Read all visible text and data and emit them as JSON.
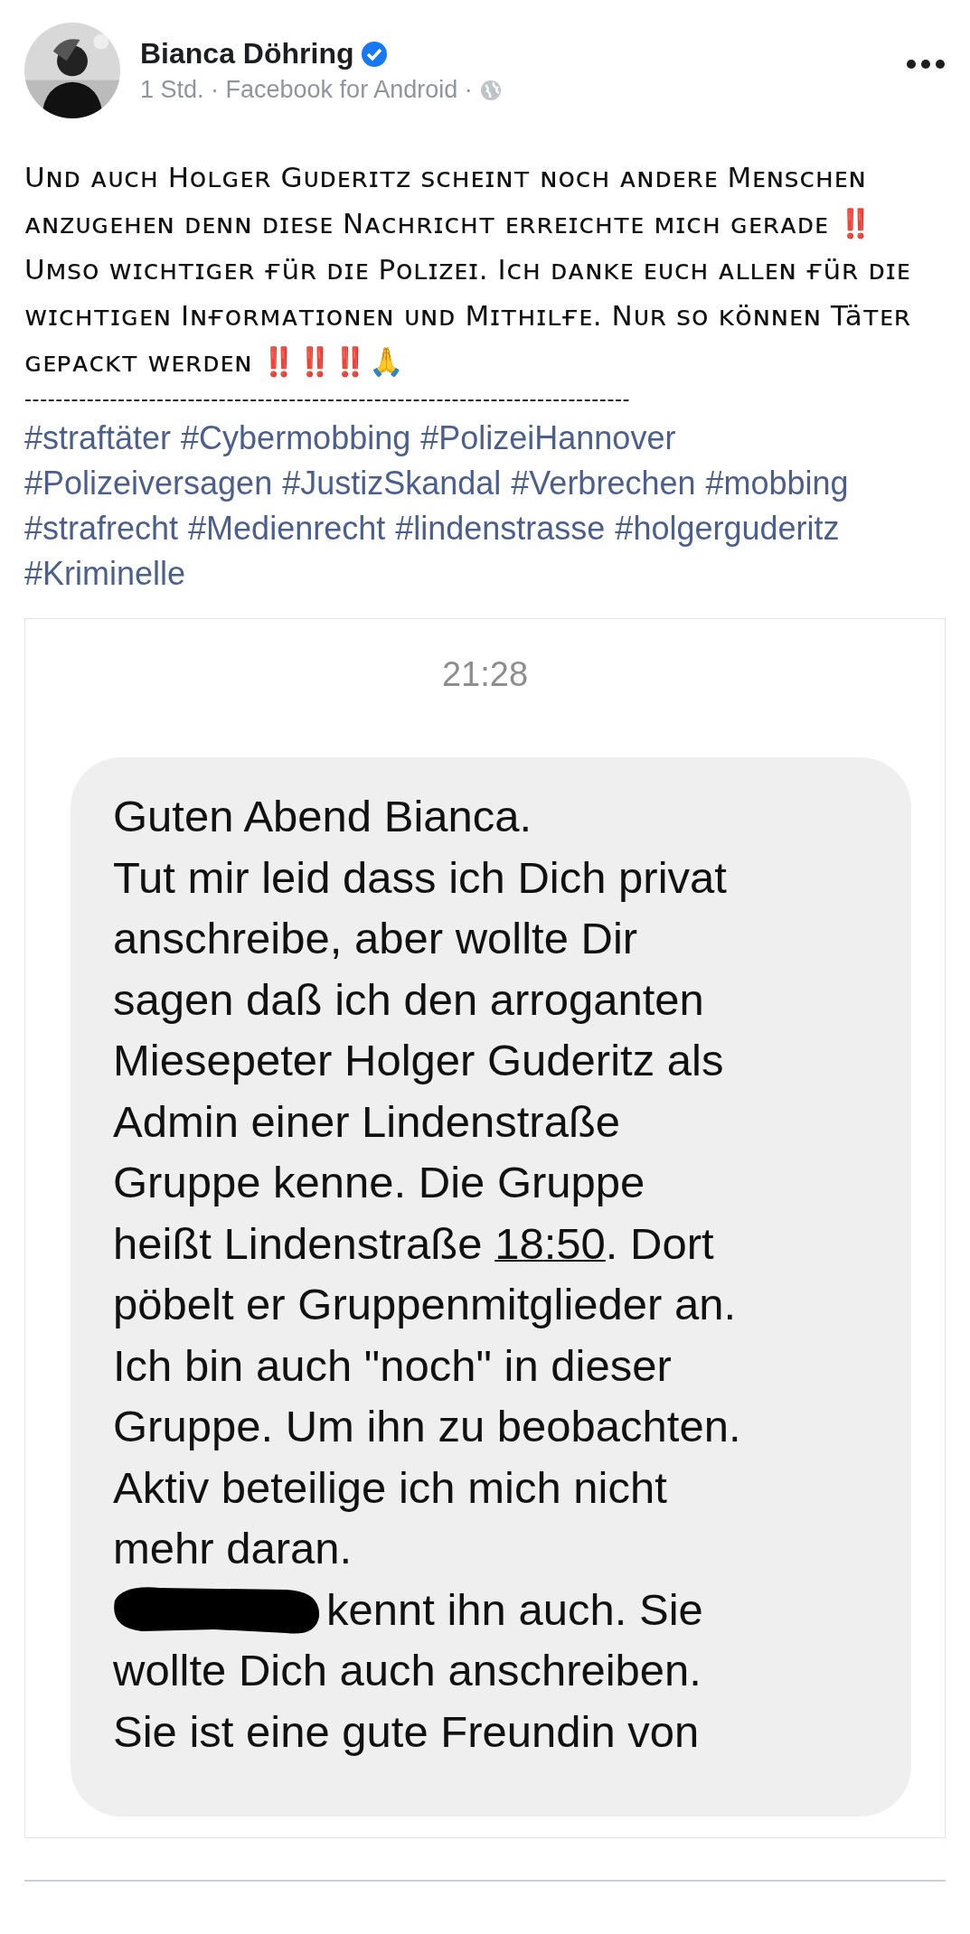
{
  "post": {
    "author": "Bianca Döhring",
    "verified": true,
    "meta": "1 Std. · Facebook for Android ·",
    "text": "Uɴᴅ ᴀᴜᴄʜ Hᴏʟɢᴇʀ Gᴜᴅᴇʀɪᴛᴢ sᴄʜᴇɪɴᴛ ɴᴏᴄʜ ᴀɴᴅᴇʀᴇ Mᴇɴsᴄʜᴇɴ ᴀɴᴢᴜɢᴇʜᴇɴ ᴅᴇɴɴ ᴅɪᴇsᴇ Nᴀᴄʜʀɪᴄʜᴛ ᴇʀʀᴇɪᴄʜᴛᴇ ᴍɪᴄʜ ɢᴇʀᴀᴅᴇ ‼️ Uᴍsᴏ ᴡɪᴄʜᴛɪɢᴇʀ ғüʀ ᴅɪᴇ Pᴏʟɪᴢᴇɪ. Iᴄʜ ᴅᴀɴᴋᴇ ᴇᴜᴄʜ ᴀʟʟᴇɴ ғüʀ ᴅɪᴇ ᴡɪᴄʜᴛɪɢᴇɴ Iɴғᴏʀᴍᴀᴛɪᴏɴᴇɴ ᴜɴᴅ Mɪᴛʜɪʟғᴇ. Nᴜʀ sᴏ ᴋöɴɴᴇɴ Täᴛᴇʀ ɢᴇᴘᴀᴄᴋᴛ ᴡᴇʀᴅᴇɴ ‼️‼️‼️🙏",
    "separator": "------------------------------------------------------------------------------",
    "hashtags": [
      "#straftäter",
      "#Cybermobbing",
      "#PolizeiHannover",
      "#Polizeiversagen",
      "#JustizSkandal",
      "#Verbrechen",
      "#mobbing",
      "#strafrecht",
      "#Medienrecht",
      "#lindenstrasse",
      "#holgerguderitz",
      "#Kriminelle"
    ],
    "screenshot": {
      "time": "21:28",
      "lines": [
        {
          "text": "Guten Abend Bianca."
        },
        {
          "text": "Tut mir leid dass ich Dich privat"
        },
        {
          "text": "anschreibe, aber wollte Dir"
        },
        {
          "text": "sagen daß ich den arroganten"
        },
        {
          "text": "Miesepeter Holger Guderitz als"
        },
        {
          "text": "Admin einer Lindenstraße"
        },
        {
          "text": "Gruppe kenne. Die Gruppe"
        },
        {
          "text": "heißt Lindenstraße ",
          "link": "18:50",
          "after": ". Dort"
        },
        {
          "text": "pöbelt er Gruppenmitglieder an."
        },
        {
          "text": "Ich bin auch \"noch\" in dieser"
        },
        {
          "text": "Gruppe. Um ihn zu beobachten."
        },
        {
          "text": "Aktiv beteilige ich mich nicht"
        },
        {
          "text": "mehr daran."
        },
        {
          "text": "kennt ihn auch. Sie",
          "redacted": true
        },
        {
          "text": "wollte Dich auch anschreiben."
        },
        {
          "text": "Sie ist eine gute Freundin von"
        }
      ]
    }
  }
}
